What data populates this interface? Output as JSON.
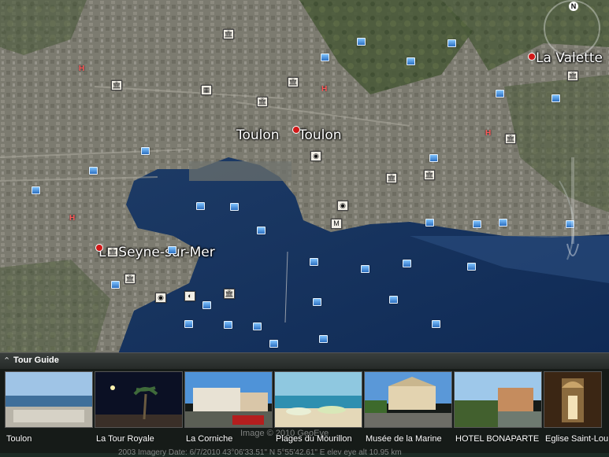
{
  "map": {
    "places": [
      {
        "id": "toulon-1",
        "label": "Toulon"
      },
      {
        "id": "toulon-2",
        "label": "Toulon"
      },
      {
        "id": "la-valette",
        "label": "La Valette"
      },
      {
        "id": "la-seyne",
        "label": "La Seyne-sur-Mer"
      }
    ],
    "compass_label": "N",
    "attribution": "Image © 2010 GeoEye"
  },
  "tour_guide": {
    "title": "Tour Guide",
    "items": [
      {
        "label": "Toulon"
      },
      {
        "label": "La Tour Royale"
      },
      {
        "label": "La Corniche"
      },
      {
        "label": "Plages du Mourillon"
      },
      {
        "label": "Musée de la Marine"
      },
      {
        "label": "HOTEL BONAPARTE"
      },
      {
        "label": "Eglise Saint-Lou"
      }
    ]
  },
  "status_bar": "2003     Imagery Date: 6/7/2010     43°06'33.51\" N    5°55'42.61\" E   elev   eye alt  10.95 km"
}
